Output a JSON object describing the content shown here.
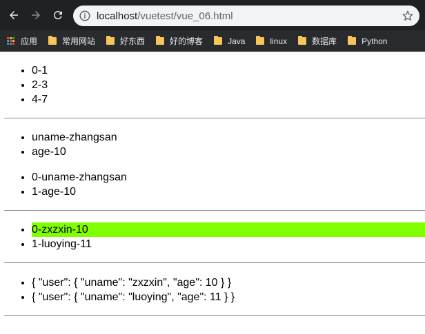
{
  "browser": {
    "url_host": "localhost",
    "url_path": "/vuetest/vue_06.html"
  },
  "bookmarks": [
    {
      "label": "应用",
      "icon": "apps-icon"
    },
    {
      "label": "常用网站",
      "icon": "folder-icon"
    },
    {
      "label": "好东西",
      "icon": "folder-icon"
    },
    {
      "label": "好的博客",
      "icon": "folder-icon"
    },
    {
      "label": "Java",
      "icon": "folder-icon"
    },
    {
      "label": "linux",
      "icon": "folder-icon"
    },
    {
      "label": "数据库",
      "icon": "folder-icon"
    },
    {
      "label": "Python",
      "icon": "folder-icon"
    }
  ],
  "list1": [
    "0-1",
    "2-3",
    "4-7"
  ],
  "list2": [
    "uname-zhangsan",
    "age-10"
  ],
  "list3": [
    "0-uname-zhangsan",
    "1-age-10"
  ],
  "list4": [
    "0-zxzxin-10",
    "1-luoying-11"
  ],
  "list5": [
    "{ \"user\": { \"uname\": \"zxzxin\", \"age\": 10 } }",
    "{ \"user\": { \"uname\": \"luoying\", \"age\": 11 } }"
  ],
  "colors": {
    "highlight": "#80ff00"
  }
}
